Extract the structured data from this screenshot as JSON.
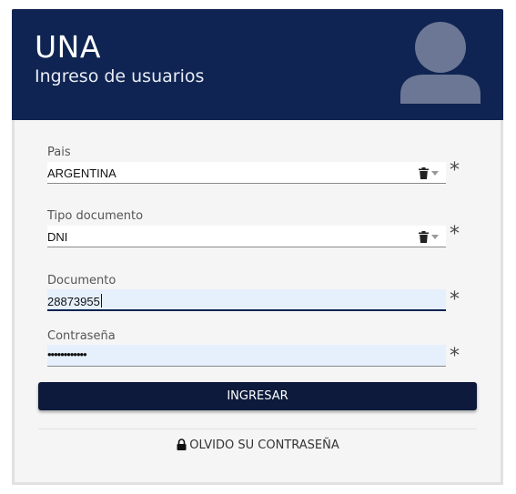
{
  "header": {
    "title": "UNA",
    "subtitle": "Ingreso de usuarios",
    "avatar_icon": "user-avatar-icon"
  },
  "form": {
    "pais": {
      "label": "Pais",
      "value": "ARGENTINA"
    },
    "tipo_documento": {
      "label": "Tipo documento",
      "value": "DNI"
    },
    "documento": {
      "label": "Documento",
      "value": "28873955"
    },
    "contrasena": {
      "label": "Contraseña",
      "value": "••••••••••••"
    },
    "required_mark": "*"
  },
  "actions": {
    "submit_label": "INGRESAR",
    "forgot_label": "OLVIDO SU CONTRASEÑA"
  },
  "colors": {
    "header_bg": "#0f2452",
    "button_bg": "#0d1a3b",
    "autofill_bg": "#e6f0fd"
  }
}
